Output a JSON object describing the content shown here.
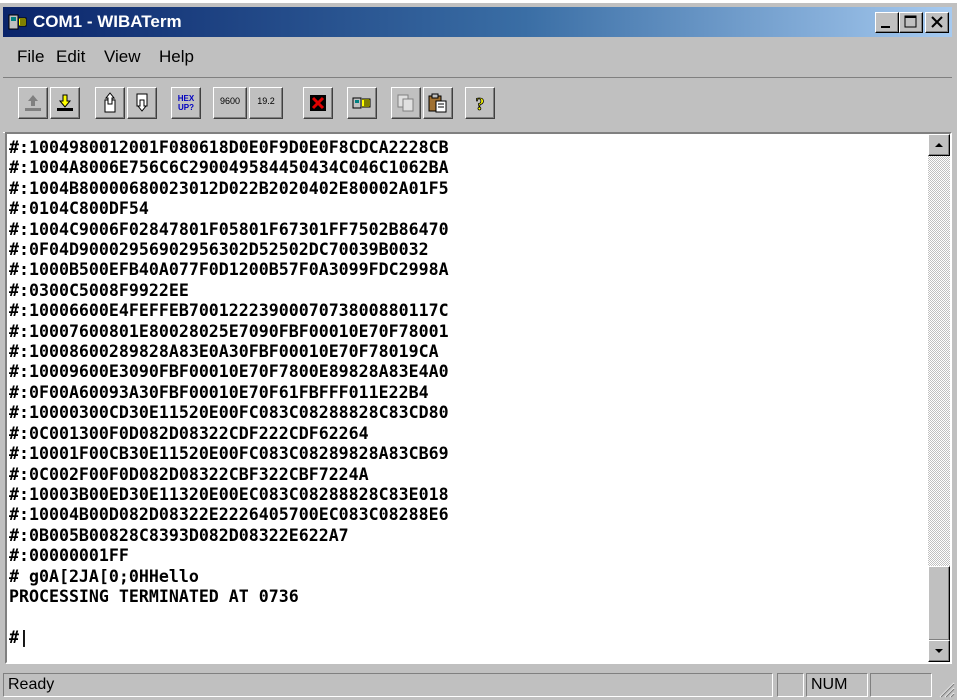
{
  "window": {
    "title": "COM1 - WIBATerm",
    "controls": [
      "minimize-icon",
      "maximize-icon",
      "close-icon"
    ]
  },
  "menu": {
    "file": "File",
    "edit": "Edit",
    "view": "View",
    "help": "Help"
  },
  "toolbar": {
    "hex_label_top": "HEX",
    "hex_label_bottom": "UP?",
    "baud_9600": "9600",
    "baud_192": "19.2",
    "buttons": [
      "upload-disabled-icon",
      "download-icon",
      "send-file-icon",
      "receive-file-icon",
      "hex-upload-icon",
      "baud-9600-icon",
      "baud-19200-icon",
      "stop-icon",
      "connect-icon",
      "copy-icon",
      "paste-icon",
      "help-icon"
    ]
  },
  "terminal": {
    "lines": [
      "#:1004980012001F080618D0E0F9D0E0F8CDCA2228CB",
      "#:1004A8006E756C6C290049584450434C046C1062BA",
      "#:1004B8000068002301 2D022B2020402E80002A01F5",
      "#:0104C800DF54",
      "#:1004C9006F02847801F05801F67301FF7502B86470",
      "#:0F04D9000295690295 6302D52502DC70039B0032",
      "#:1000B500EFB40A077F0D1200B57F0A3099FDC2998A",
      "#:0300C5008F9922EE",
      "#:10006600E4FEFFEB7001222390007073800880117C",
      "#:10007600801E80028025E7090FBF00010E70F78001",
      "#:10008600289828A83E0A30FBF00010E70F78019CA",
      "#:10009600E3090FBF00010E70F7800E89828A83E4A0",
      "#:0F00A60093A30FBF00010E70F61FBFFF011E22B4",
      "#:10000300CD30E11520E00FC083C08288828C83CD80",
      "#:0C001300F0D082D08322CDF222CDF62264",
      "#:10001F00CB30E11520E00FC083C08289828A83CB69",
      "#:0C002F00F0D082D08322CBF322CBF7224A",
      "#:10003B00ED30E11320E00EC083C08288828C83E018",
      "#:10004B00D082D08322E2226405700EC083C08288E6",
      "#:0B005B00828C8393D082D08322E622A7",
      "#:00000001FF",
      "# g0A[2JA[0;0HHello",
      "PROCESSING TERMINATED AT 0736",
      "",
      "#|"
    ]
  },
  "scrollbar": {
    "up_arrow": "scroll-up-arrow-icon",
    "down_arrow": "scroll-down-arrow-icon"
  },
  "status": {
    "text": "Ready",
    "num": "NUM"
  }
}
